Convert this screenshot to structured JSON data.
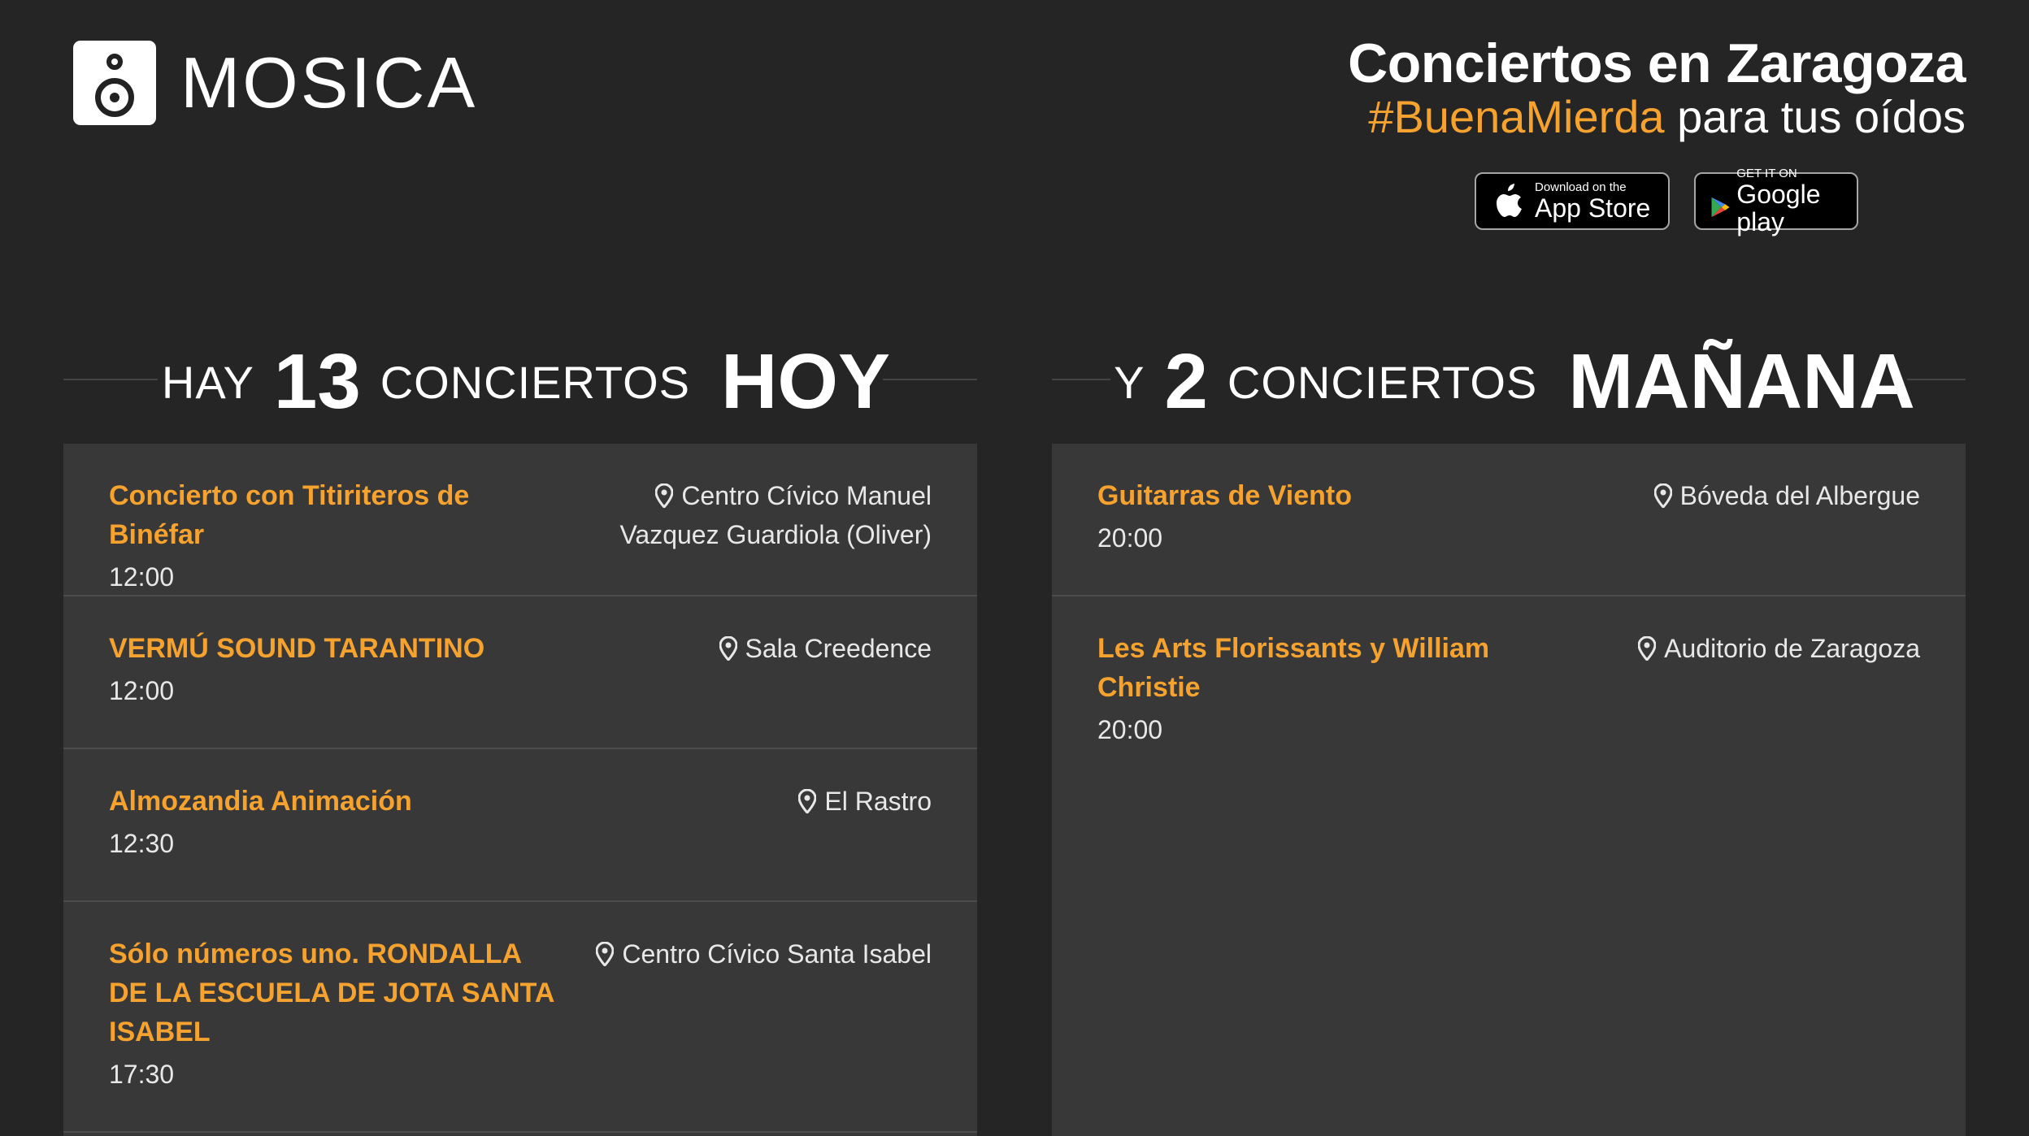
{
  "brand": {
    "name": "MOSICA"
  },
  "header": {
    "title": "Conciertos en Zaragoza",
    "hashtag": "#BuenaMierda",
    "tagline_rest": " para tus oídos"
  },
  "stores": {
    "apple_small": "Download on the",
    "apple_big": "App Store",
    "google_small": "GET IT ON",
    "google_big": "Google play"
  },
  "today": {
    "prefix": "HAY",
    "count": "13",
    "word": "CONCIERTOS",
    "day": "HOY",
    "events": [
      {
        "name": "Concierto con Titiriteros de Binéfar",
        "time": "12:00",
        "venue": "Centro Cívico Manuel Vazquez Guardiola (Oliver)"
      },
      {
        "name": "VERMÚ SOUND TARANTINO",
        "time": "12:00",
        "venue": "Sala Creedence"
      },
      {
        "name": "Almozandia Animación",
        "time": "12:30",
        "venue": "El Rastro"
      },
      {
        "name": "Sólo números uno. RONDALLA DE LA ESCUELA DE JOTA SANTA ISABEL",
        "time": "17:30",
        "venue": "Centro Cívico Santa Isabel"
      }
    ]
  },
  "tomorrow": {
    "prefix": "Y",
    "count": "2",
    "word": "CONCIERTOS",
    "day": "MAÑANA",
    "events": [
      {
        "name": "Guitarras de Viento",
        "time": "20:00",
        "venue": "Bóveda del Albergue"
      },
      {
        "name": "Les Arts Florissants y William Christie",
        "time": "20:00",
        "venue": "Auditorio de Zaragoza"
      }
    ]
  },
  "icons": {
    "venue": "map-pin-icon",
    "apple": "apple-icon",
    "google_play": "google-play-icon",
    "logo": "speaker-icon"
  },
  "colors": {
    "accent": "#f6a22f",
    "background": "#252525",
    "panel": "#383838"
  }
}
